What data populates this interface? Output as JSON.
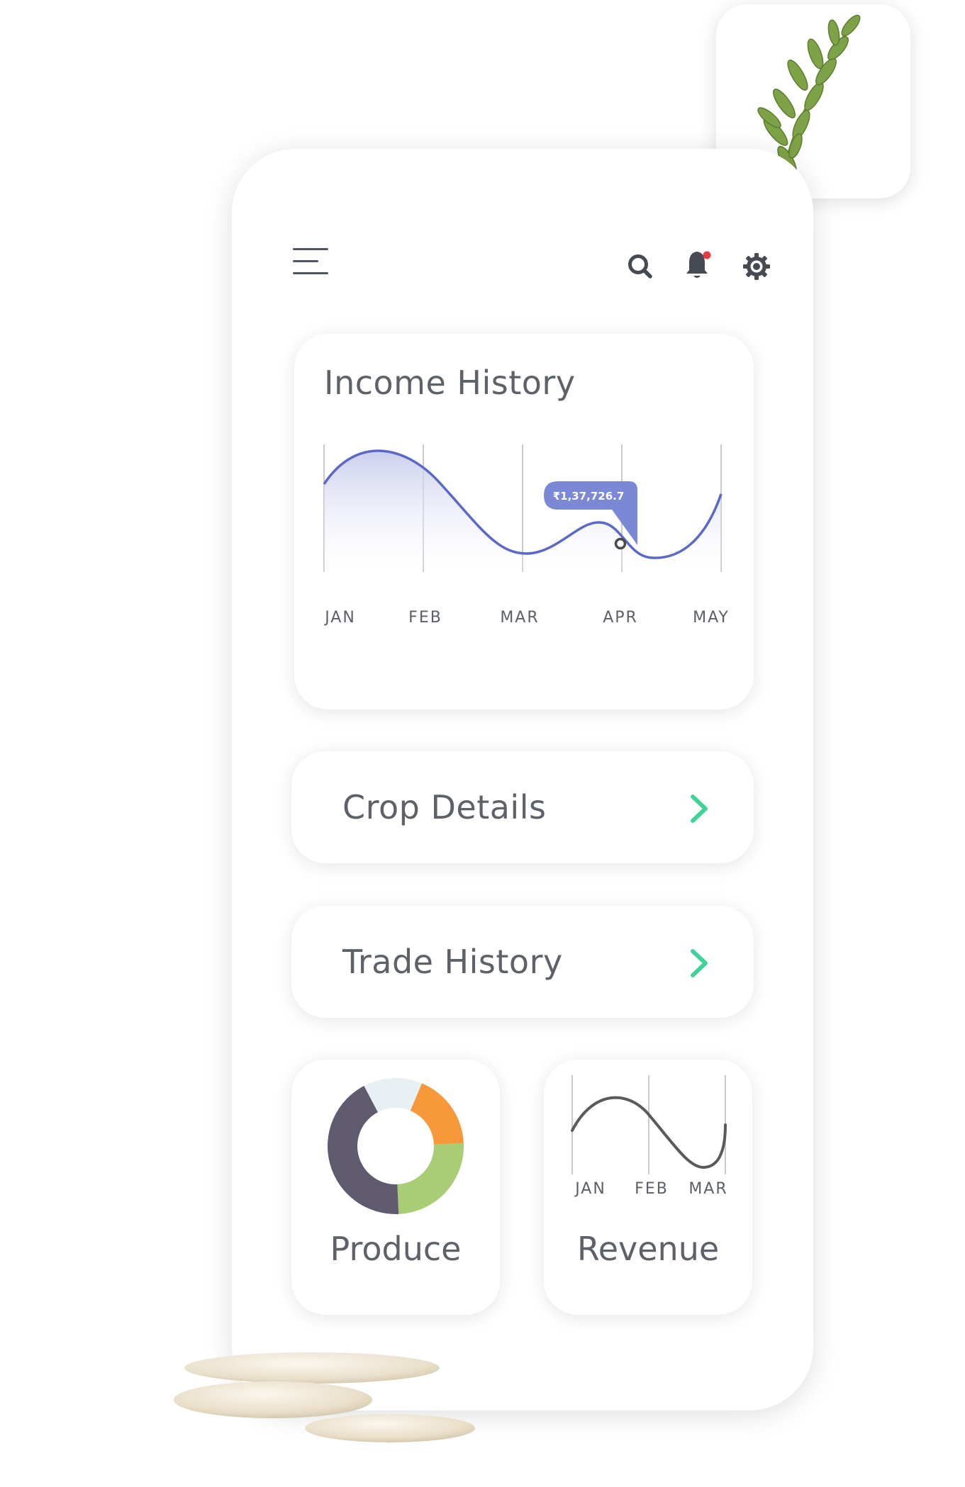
{
  "header": {
    "icons": [
      "menu-icon",
      "search-icon",
      "bell-icon",
      "gear-icon"
    ],
    "notification_dot_color": "#e8393c"
  },
  "income_history": {
    "title": "Income History",
    "tooltip": "₹1,37,726.7",
    "accent_color": "#7b88d6"
  },
  "crop_details": {
    "label": "Crop Details",
    "chevron_color": "#3fd39a"
  },
  "trade_history": {
    "label": "Trade History",
    "chevron_color": "#3fd39a"
  },
  "produce": {
    "label": "Produce"
  },
  "revenue": {
    "label": "Revenue"
  },
  "chart_data": [
    {
      "type": "line",
      "title": "Income History",
      "categories": [
        "JAN",
        "FEB",
        "MAR",
        "APR",
        "MAY"
      ],
      "highlight": {
        "category": "APR",
        "label": "₹1,37,726.7"
      },
      "grid": "vertical lines at each month"
    },
    {
      "type": "pie",
      "title": "Produce",
      "donut": true,
      "slices": [
        {
          "value": 14,
          "color": "#e8f0f3"
        },
        {
          "value": 18,
          "color": "#f7993b"
        },
        {
          "value": 25,
          "color": "#a8cd74"
        },
        {
          "value": 43,
          "color": "#5f5a6e"
        }
      ]
    },
    {
      "type": "line",
      "title": "Revenue",
      "categories": [
        "JAN",
        "FEB",
        "MAR"
      ],
      "grid": "vertical lines at each month"
    }
  ]
}
